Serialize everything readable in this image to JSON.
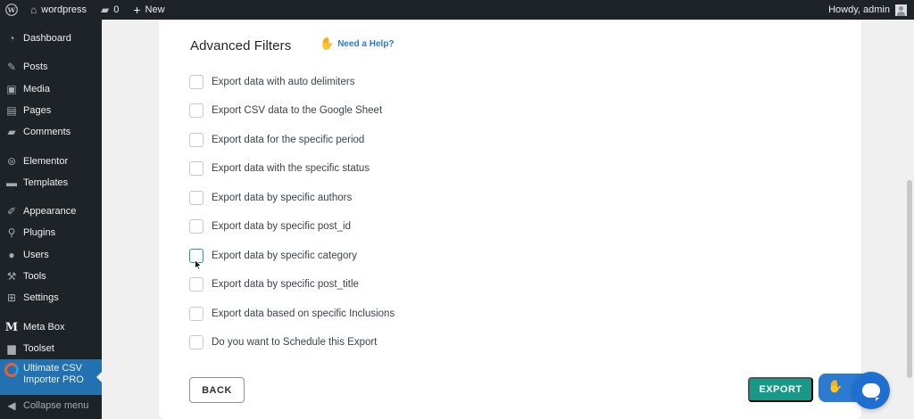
{
  "adminbar": {
    "site_name": "wordpress",
    "comments_count": "0",
    "new_label": "New",
    "howdy": "Howdy, admin"
  },
  "sidebar": {
    "items": [
      {
        "label": "Dashboard",
        "icon": "dashboard-icon"
      },
      {
        "label": "Posts",
        "icon": "pin-icon"
      },
      {
        "label": "Media",
        "icon": "media-icon"
      },
      {
        "label": "Pages",
        "icon": "pages-icon"
      },
      {
        "label": "Comments",
        "icon": "comment-icon"
      },
      {
        "label": "Elementor",
        "icon": "elementor-icon"
      },
      {
        "label": "Templates",
        "icon": "folder-icon"
      },
      {
        "label": "Appearance",
        "icon": "brush-icon"
      },
      {
        "label": "Plugins",
        "icon": "plug-icon"
      },
      {
        "label": "Users",
        "icon": "user-icon"
      },
      {
        "label": "Tools",
        "icon": "wrench-icon"
      },
      {
        "label": "Settings",
        "icon": "settings-icon"
      },
      {
        "label": "Meta Box",
        "icon": "metabox-icon"
      },
      {
        "label": "Toolset",
        "icon": "toolset-icon"
      },
      {
        "label": "Ultimate CSV Importer PRO",
        "icon": "csv-importer-icon",
        "current": true
      },
      {
        "label": "Collapse menu",
        "icon": "collapse-icon"
      }
    ]
  },
  "filters": {
    "title": "Advanced Filters",
    "help_link": "Need a Help?",
    "options": [
      {
        "label": "Export data with auto delimiters",
        "checked": false
      },
      {
        "label": "Export CSV data to the Google Sheet",
        "checked": false
      },
      {
        "label": "Export data for the specific period",
        "checked": false
      },
      {
        "label": "Export data with the specific status",
        "checked": false
      },
      {
        "label": "Export data by specific authors",
        "checked": false
      },
      {
        "label": "Export data by specific post_id",
        "checked": false
      },
      {
        "label": "Export data by specific category",
        "checked": false,
        "focused": true
      },
      {
        "label": "Export data by specific post_title",
        "checked": false
      },
      {
        "label": "Export data based on specific Inclusions",
        "checked": false
      },
      {
        "label": "Do you want to Schedule this Export",
        "checked": false
      }
    ]
  },
  "actions": {
    "back_label": "BACK",
    "export_label": "EXPORT"
  },
  "colors": {
    "admin_bg": "#1d2327",
    "accent_blue": "#2271b1",
    "export_teal": "#169a87",
    "link_blue": "#2b7bd3"
  }
}
